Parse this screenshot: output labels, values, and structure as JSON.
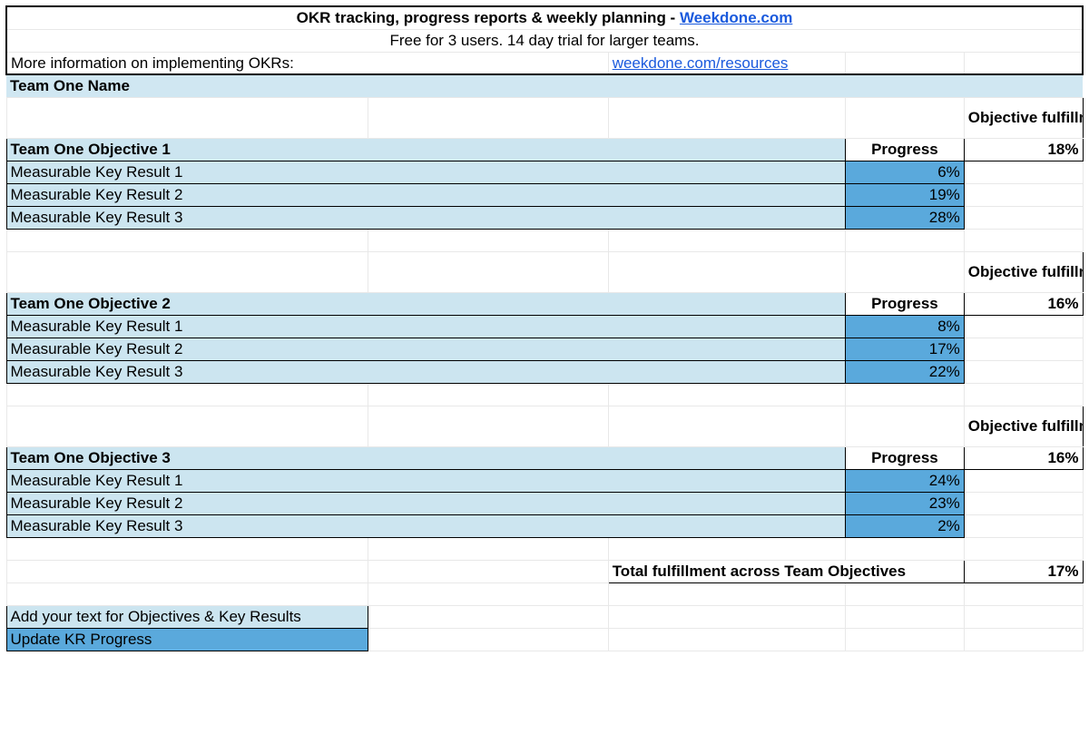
{
  "header": {
    "title_prefix": "OKR tracking, progress reports & weekly planning - ",
    "title_link": "Weekdone.com",
    "subtitle": "Free for 3 users. 14 day trial for larger teams.",
    "info_label": "More information on implementing OKRs:",
    "info_link": "weekdone.com/resources"
  },
  "team_name": "Team One Name",
  "labels": {
    "obj_fulfillment": "Objective fulfillment",
    "progress": "Progress"
  },
  "objectives": [
    {
      "title": "Team One Objective 1",
      "fulfillment": "18%",
      "krs": [
        {
          "name": "Measurable Key Result 1",
          "progress": "6%"
        },
        {
          "name": "Measurable Key Result 2",
          "progress": "19%"
        },
        {
          "name": "Measurable Key Result 3",
          "progress": "28%"
        }
      ]
    },
    {
      "title": "Team One Objective 2",
      "fulfillment": "16%",
      "krs": [
        {
          "name": "Measurable Key Result 1",
          "progress": "8%"
        },
        {
          "name": "Measurable Key Result 2",
          "progress": "17%"
        },
        {
          "name": "Measurable Key Result 3",
          "progress": "22%"
        }
      ]
    },
    {
      "title": "Team One Objective 3",
      "fulfillment": "16%",
      "krs": [
        {
          "name": "Measurable Key Result 1",
          "progress": "24%"
        },
        {
          "name": "Measurable Key Result 2",
          "progress": "23%"
        },
        {
          "name": "Measurable Key Result 3",
          "progress": "2%"
        }
      ]
    }
  ],
  "total": {
    "label": "Total fulfillment across Team Objectives",
    "value": "17%"
  },
  "legend": {
    "row1": "Add your text for Objectives & Key Results",
    "row2": "Update KR Progress"
  }
}
